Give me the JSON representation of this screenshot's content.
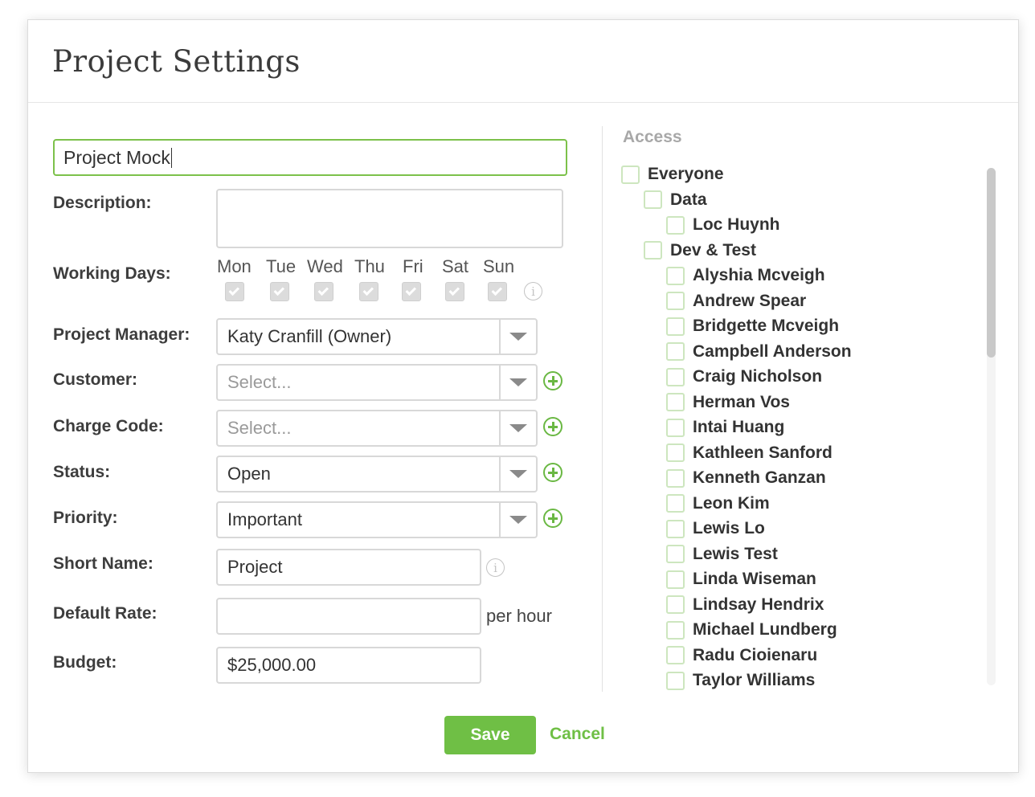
{
  "dialog": {
    "title": "Project Settings"
  },
  "form": {
    "project_name": "Project Mock",
    "description_label": "Description:",
    "description_value": "",
    "working_days_label": "Working Days:",
    "days": [
      {
        "label": "Mon",
        "checked": true
      },
      {
        "label": "Tue",
        "checked": true
      },
      {
        "label": "Wed",
        "checked": true
      },
      {
        "label": "Thu",
        "checked": true
      },
      {
        "label": "Fri",
        "checked": true
      },
      {
        "label": "Sat",
        "checked": true
      },
      {
        "label": "Sun",
        "checked": true
      }
    ],
    "project_manager_label": "Project Manager:",
    "project_manager_value": "Katy Cranfill (Owner)",
    "customer_label": "Customer:",
    "customer_placeholder": "Select...",
    "charge_code_label": "Charge Code:",
    "charge_code_placeholder": "Select...",
    "status_label": "Status:",
    "status_value": "Open",
    "priority_label": "Priority:",
    "priority_value": "Important",
    "short_name_label": "Short Name:",
    "short_name_value": "Project",
    "default_rate_label": "Default Rate:",
    "default_rate_value": "",
    "default_rate_suffix": "per hour",
    "budget_label": "Budget:",
    "budget_value": "$25,000.00"
  },
  "access": {
    "title": "Access",
    "items": [
      {
        "label": "Everyone",
        "level": 0,
        "checked": false
      },
      {
        "label": "Data",
        "level": 1,
        "checked": false
      },
      {
        "label": "Loc Huynh",
        "level": 2,
        "checked": false
      },
      {
        "label": "Dev & Test",
        "level": 1,
        "checked": false
      },
      {
        "label": "Alyshia Mcveigh",
        "level": 2,
        "checked": false
      },
      {
        "label": "Andrew Spear",
        "level": 2,
        "checked": false
      },
      {
        "label": "Bridgette Mcveigh",
        "level": 2,
        "checked": false
      },
      {
        "label": "Campbell Anderson",
        "level": 2,
        "checked": false
      },
      {
        "label": "Craig Nicholson",
        "level": 2,
        "checked": false
      },
      {
        "label": "Herman Vos",
        "level": 2,
        "checked": false
      },
      {
        "label": "Intai Huang",
        "level": 2,
        "checked": false
      },
      {
        "label": "Kathleen Sanford",
        "level": 2,
        "checked": false
      },
      {
        "label": "Kenneth Ganzan",
        "level": 2,
        "checked": false
      },
      {
        "label": "Leon Kim",
        "level": 2,
        "checked": false
      },
      {
        "label": "Lewis Lo",
        "level": 2,
        "checked": false
      },
      {
        "label": "Lewis Test",
        "level": 2,
        "checked": false
      },
      {
        "label": "Linda Wiseman",
        "level": 2,
        "checked": false
      },
      {
        "label": "Lindsay Hendrix",
        "level": 2,
        "checked": false
      },
      {
        "label": "Michael Lundberg",
        "level": 2,
        "checked": false
      },
      {
        "label": "Radu Cioienaru",
        "level": 2,
        "checked": false
      },
      {
        "label": "Taylor Williams",
        "level": 2,
        "checked": false
      }
    ]
  },
  "actions": {
    "save_label": "Save",
    "cancel_label": "Cancel"
  },
  "colors": {
    "accent": "#6fbf45",
    "focus_border": "#7cc14a",
    "field_border": "#d8d8d8"
  },
  "icons": {
    "add": "plus-circle-icon",
    "info": "info-icon",
    "dropdown": "chevron-down-icon"
  }
}
